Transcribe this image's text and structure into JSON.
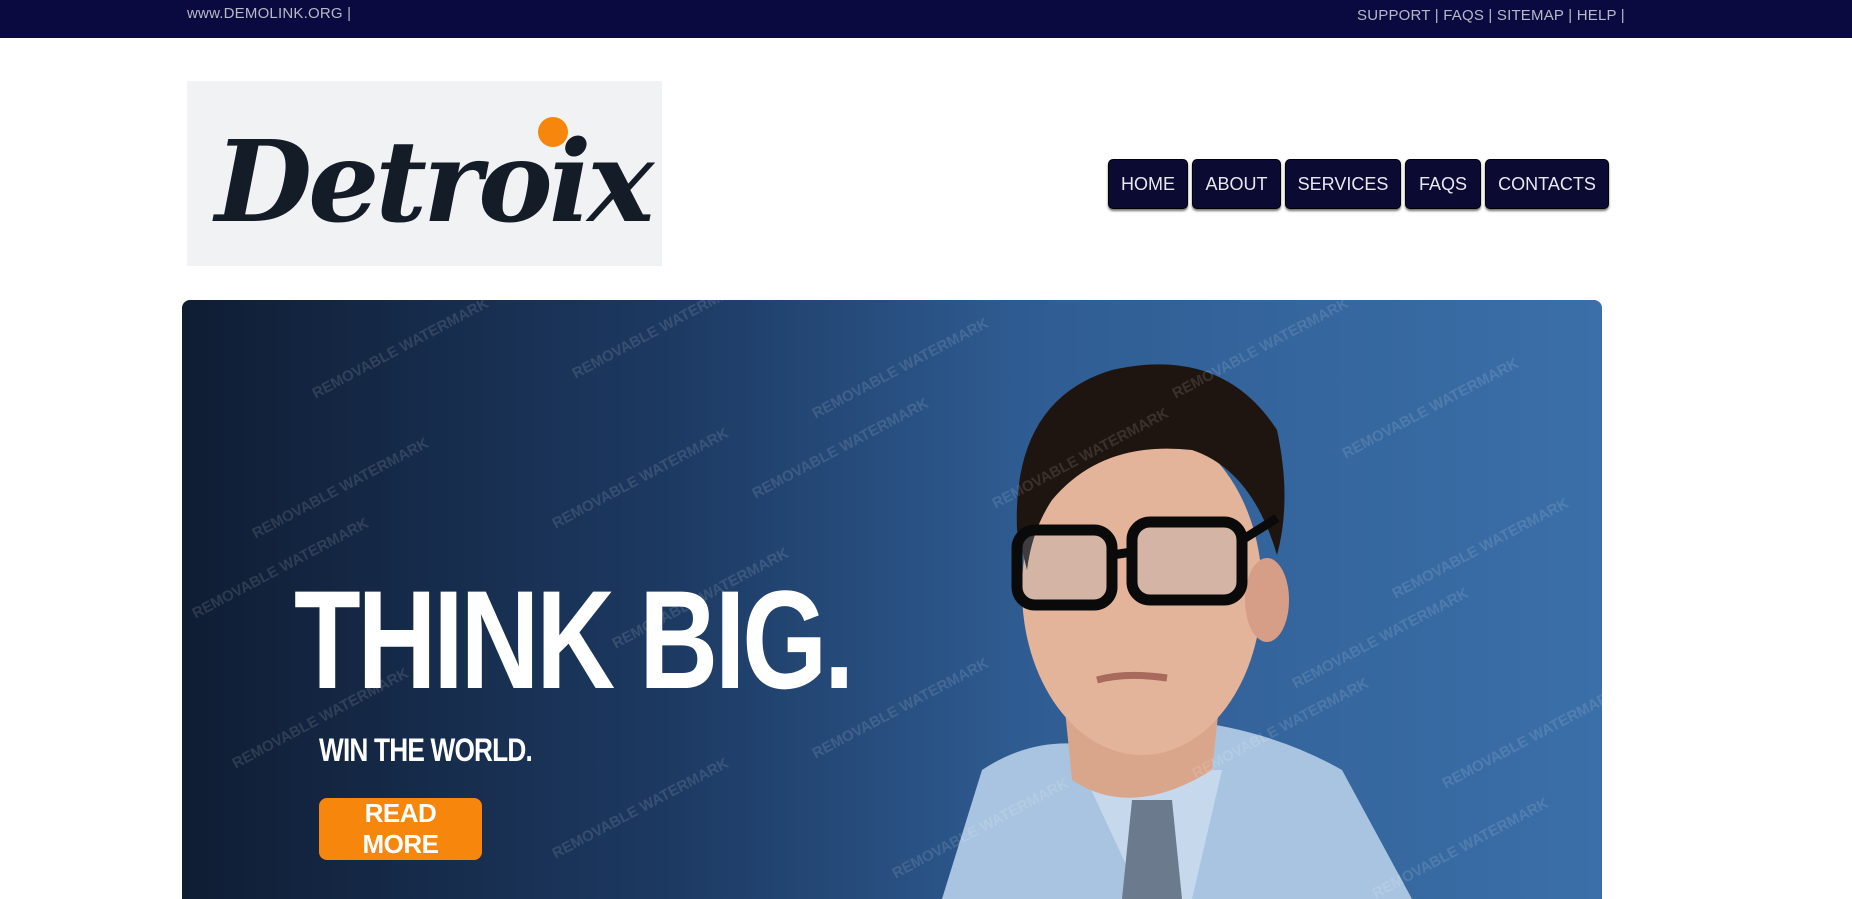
{
  "topbar": {
    "domain_text": "www.DEMOLINK.ORG |",
    "links": [
      {
        "label": "SUPPORT |"
      },
      {
        "label": "FAQS |"
      },
      {
        "label": "SITEMAP |"
      },
      {
        "label": "HELP |"
      }
    ]
  },
  "logo": {
    "text": "Detroix",
    "dot_color": "#f7860c"
  },
  "nav": {
    "items": [
      {
        "label": "HOME"
      },
      {
        "label": "ABOUT"
      },
      {
        "label": "SERVICES"
      },
      {
        "label": "FAQS"
      },
      {
        "label": "CONTACTS"
      }
    ]
  },
  "hero": {
    "title": "THINK BIG.",
    "subtitle": "WIN THE WORLD.",
    "button_label": "READ MORE",
    "watermark_text": "REMOVABLE WATERMARK",
    "accent_color": "#f7860c"
  },
  "colors": {
    "topbar_bg": "#0b0a40",
    "nav_bg": "#0b0a33"
  }
}
